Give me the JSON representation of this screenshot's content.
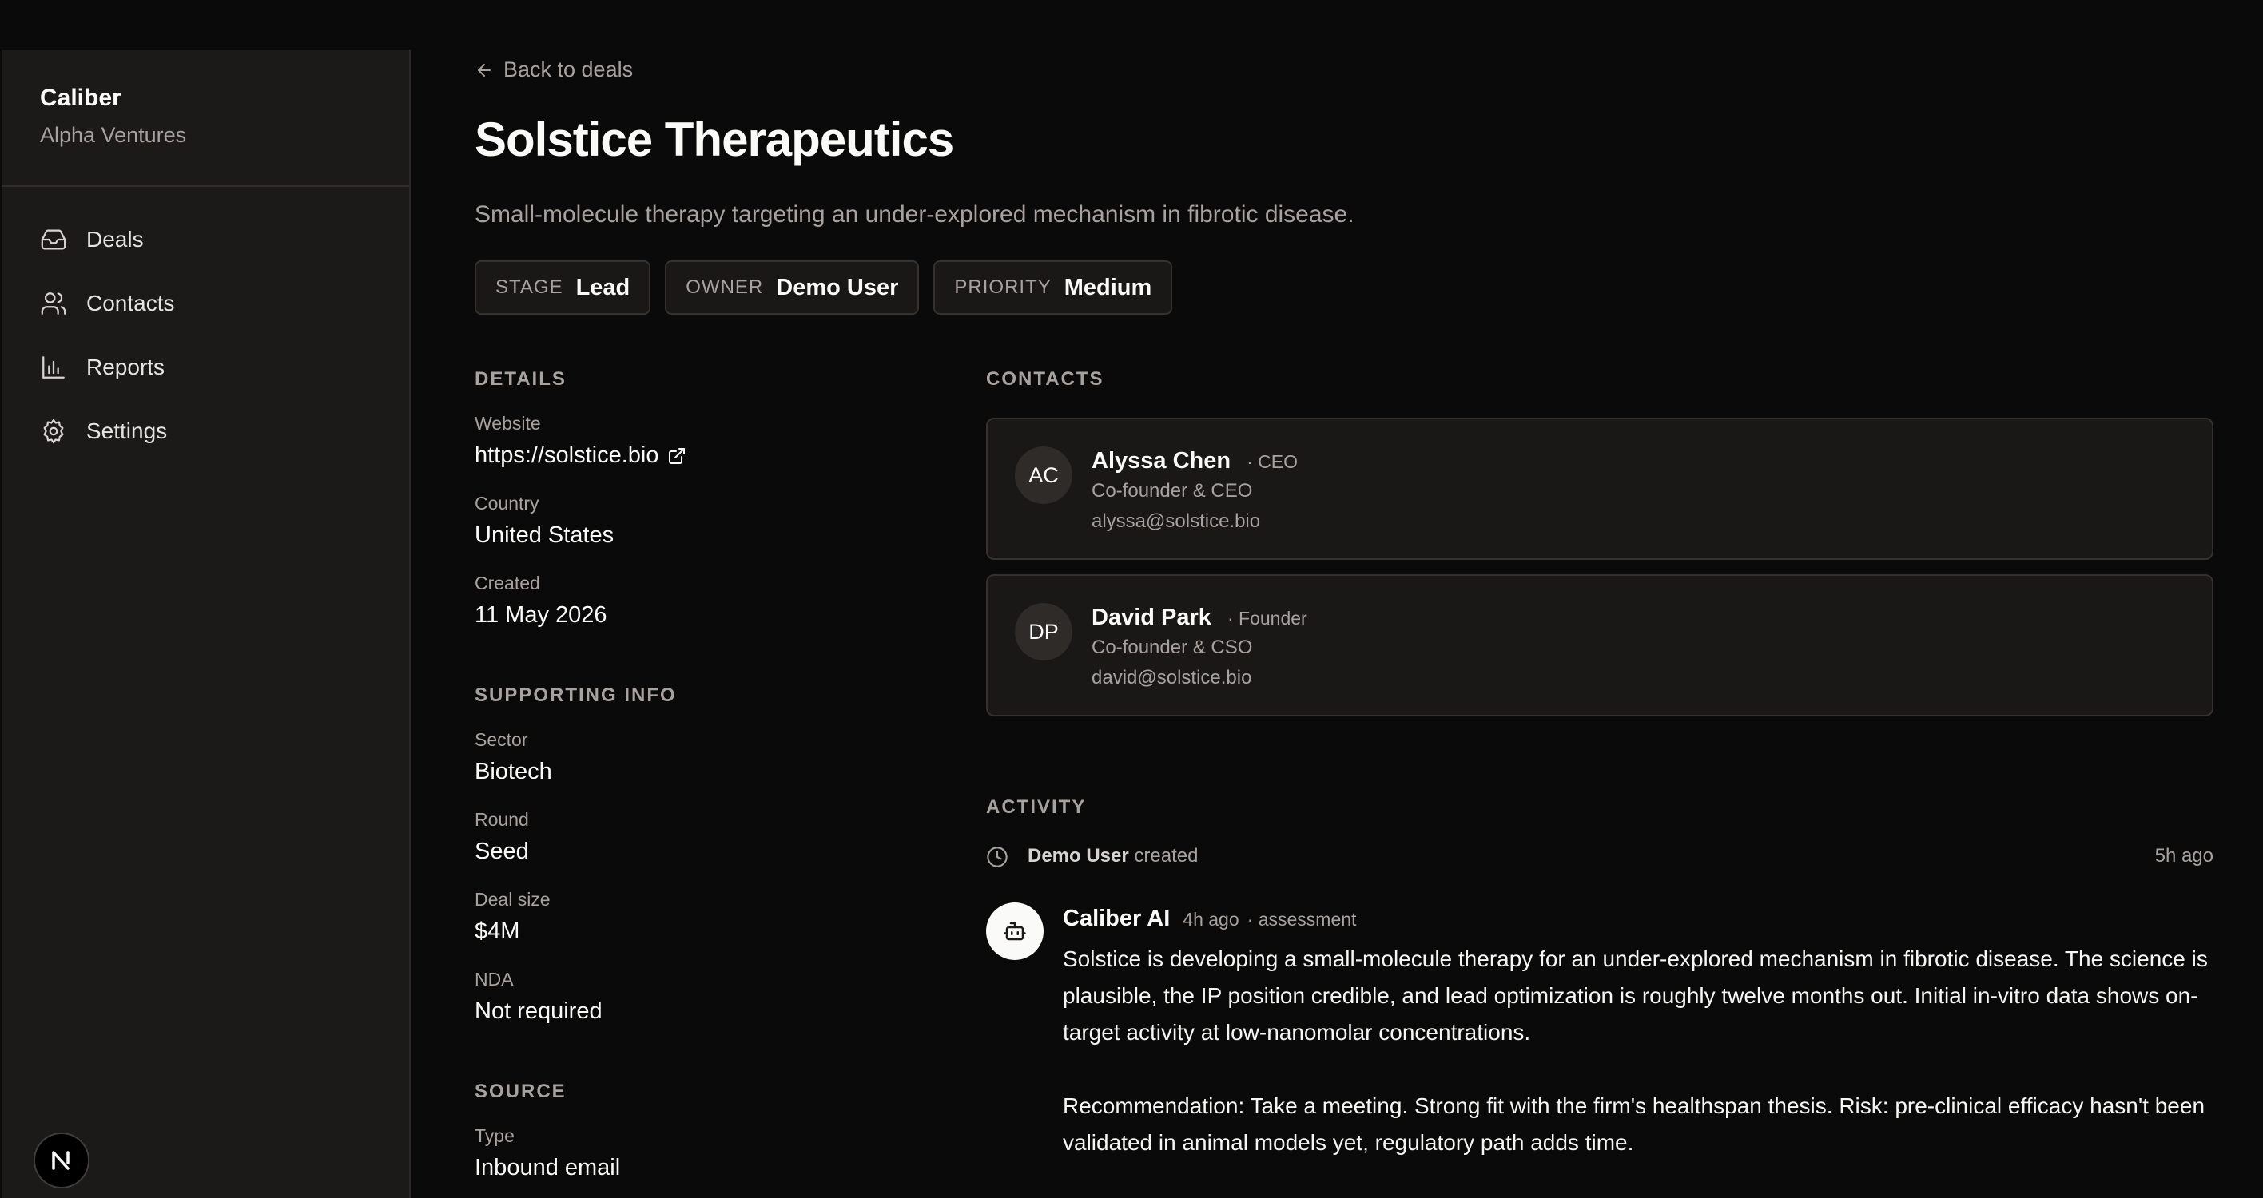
{
  "sidebar": {
    "org_name": "Caliber",
    "org_sub": "Alpha Ventures",
    "items": [
      {
        "label": "Deals",
        "icon": "inbox-icon"
      },
      {
        "label": "Contacts",
        "icon": "users-icon"
      },
      {
        "label": "Reports",
        "icon": "bar-chart-icon"
      },
      {
        "label": "Settings",
        "icon": "gear-icon"
      }
    ],
    "badge_letter": "N"
  },
  "main": {
    "back_label": "Back to deals",
    "title": "Solstice Therapeutics",
    "subtitle": "Small-molecule therapy targeting an under-explored mechanism in fibrotic disease.",
    "pills": [
      {
        "key": "STAGE",
        "value": "Lead"
      },
      {
        "key": "OWNER",
        "value": "Demo User"
      },
      {
        "key": "PRIORITY",
        "value": "Medium"
      }
    ]
  },
  "details": {
    "heading": "DETAILS",
    "website_label": "Website",
    "website": "https://solstice.bio",
    "country_label": "Country",
    "country": "United States",
    "created_label": "Created",
    "created": "11 May 2026"
  },
  "supporting": {
    "heading": "SUPPORTING INFO",
    "sector_label": "Sector",
    "sector": "Biotech",
    "round_label": "Round",
    "round": "Seed",
    "size_label": "Deal size",
    "size": "$4M",
    "nda_label": "NDA",
    "nda": "Not required"
  },
  "source": {
    "heading": "SOURCE",
    "type_label": "Type",
    "type": "Inbound email"
  },
  "contacts": {
    "heading": "CONTACTS",
    "items": [
      {
        "initials": "AC",
        "name": "Alyssa Chen",
        "role_tag": "· CEO",
        "title": "Co-founder & CEO",
        "email": "alyssa@solstice.bio"
      },
      {
        "initials": "DP",
        "name": "David Park",
        "role_tag": "· Founder",
        "title": "Co-founder & CSO",
        "email": "david@solstice.bio"
      }
    ]
  },
  "activity": {
    "heading": "ACTIVITY",
    "event": {
      "actor": "Demo User",
      "action": " created",
      "time": "5h ago"
    },
    "ai": {
      "name": "Caliber AI",
      "time": "4h ago",
      "tag": "· assessment",
      "para1": "Solstice is developing a small-molecule therapy for an under-explored mechanism in fibrotic disease. The science is plausible, the IP position credible, and lead optimization is roughly twelve months out. Initial in-vitro data shows on-target activity at low-nanomolar concentrations.",
      "para2": "Recommendation: Take a meeting. Strong fit with the firm's healthspan thesis. Risk: pre-clinical efficacy hasn't been validated in animal models yet, regulatory path adds time."
    }
  }
}
